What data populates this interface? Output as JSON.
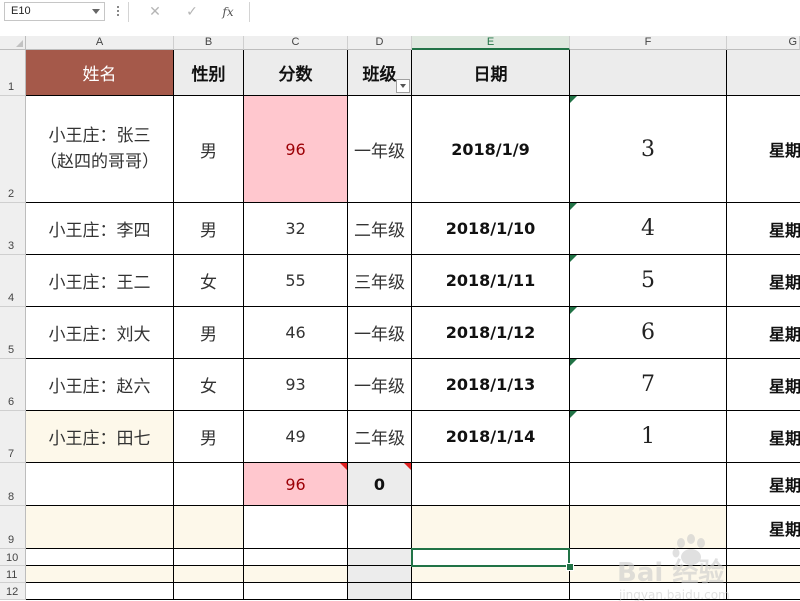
{
  "name_box": {
    "value": "E10"
  },
  "formula_bar": {
    "cancel_icon": "✕",
    "enter_icon": "✓",
    "fx_icon": "fx",
    "formula": ""
  },
  "columns": [
    "A",
    "B",
    "C",
    "D",
    "E",
    "F",
    "G"
  ],
  "active_column": "E",
  "rows": [
    "1",
    "2",
    "3",
    "4",
    "5",
    "6",
    "7",
    "8",
    "9",
    "10",
    "11",
    "12"
  ],
  "sheet": {
    "headers": [
      "姓名",
      "性别",
      "分数",
      "班级",
      "日期",
      ""
    ],
    "records": [
      {
        "name": "小王庄：张三（赵四的哥哥）",
        "gender": "男",
        "score": "96",
        "class": "一年级",
        "date": "2018/1/9",
        "num": "3",
        "week": "星期"
      },
      {
        "name": "小王庄：李四",
        "gender": "男",
        "score": "32",
        "class": "二年级",
        "date": "2018/1/10",
        "num": "4",
        "week": "星期"
      },
      {
        "name": "小王庄：王二",
        "gender": "女",
        "score": "55",
        "class": "三年级",
        "date": "2018/1/11",
        "num": "5",
        "week": "星期"
      },
      {
        "name": "小王庄：刘大",
        "gender": "男",
        "score": "46",
        "class": "一年级",
        "date": "2018/1/12",
        "num": "6",
        "week": "星期"
      },
      {
        "name": "小王庄：赵六",
        "gender": "女",
        "score": "93",
        "class": "一年级",
        "date": "2018/1/13",
        "num": "7",
        "week": "星期"
      },
      {
        "name": "小王庄：田七",
        "gender": "男",
        "score": "49",
        "class": "二年级",
        "date": "2018/1/14",
        "num": "1",
        "week": "星期"
      }
    ],
    "row8": {
      "score": "96",
      "class": "0",
      "week": "星期"
    },
    "row9": {
      "week": "星期"
    }
  },
  "colors": {
    "header_name_bg": "#a5594a",
    "highlight_pink": "#ffc7ce",
    "highlight_text": "#9c0006",
    "selection": "#217346",
    "cream_row": "#fdf8ea"
  },
  "watermark": {
    "logo": "Bai 经验",
    "url": "jingyan.baidu.com"
  }
}
